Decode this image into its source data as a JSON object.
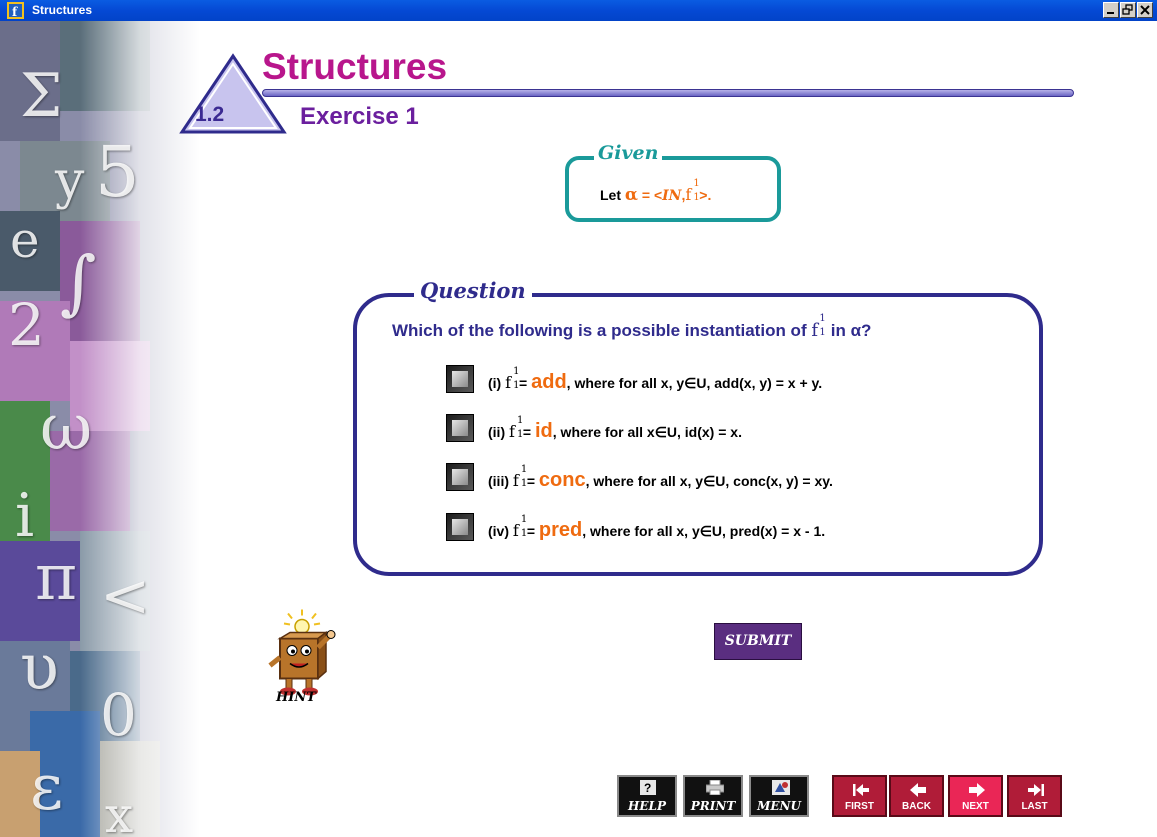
{
  "window": {
    "title": "Structures"
  },
  "header": {
    "title": "Structures",
    "section_number": "1.2",
    "subtitle": "Exercise 1"
  },
  "given": {
    "label": "Given",
    "let": "Let",
    "alpha": "α",
    "equals": "= <",
    "domain": "IN",
    "comma": ",",
    "close": ">."
  },
  "question": {
    "label": "Question",
    "text_before": "Which of the following is a possible instantiation of",
    "text_after": "in α?",
    "options": [
      {
        "prefix": "(i)",
        "fname": "add",
        "rest": ", where for all x, y∈U, add(x, y) = x + y."
      },
      {
        "prefix": "(ii)",
        "fname": "id",
        "rest": ", where for all x∈U, id(x) = x."
      },
      {
        "prefix": "(iii)",
        "fname": "conc",
        "rest": ", where for all x, y∈U, conc(x, y) = xy."
      },
      {
        "prefix": "(iv)",
        "fname": "pred",
        "rest": ", where for all x, y∈U, pred(x) = x - 1."
      }
    ]
  },
  "hint": {
    "label": "HINT"
  },
  "submit": {
    "label": "SUBMIT"
  },
  "toolbar": {
    "help": "HELP",
    "print": "PRINT",
    "menu": "MENU"
  },
  "nav": {
    "first": "FIRST",
    "back": "BACK",
    "next": "NEXT",
    "last": "LAST"
  },
  "math": {
    "f": "f",
    "one": "1"
  }
}
